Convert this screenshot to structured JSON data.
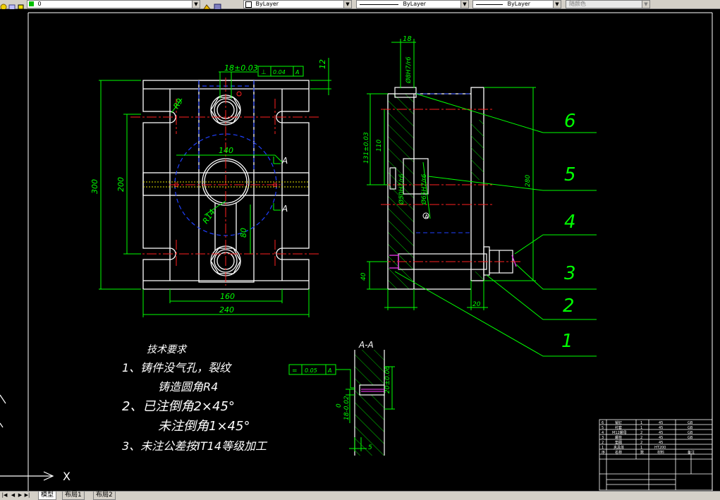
{
  "toolbar": {
    "layer_name": "0",
    "color_label": "ByLayer",
    "linetype_label": "ByLayer",
    "lineweight_label": "ByLayer",
    "plotstyle_label": "随颜色"
  },
  "tabs": [
    {
      "label": "模型",
      "active": true
    },
    {
      "label": "布局1",
      "active": false
    },
    {
      "label": "布局2",
      "active": false
    }
  ],
  "ucs": {
    "x_label": "X"
  },
  "drawing": {
    "front_view": {
      "dim_top": "18±0.03",
      "tolerance_frame": [
        "⊥",
        "0.04",
        "A"
      ],
      "dim_right_top": "12",
      "dim_radius_r9": "R9",
      "dim_140": "140",
      "dim_r14": "R14",
      "dim_80": "80",
      "dim_height_300": "300",
      "dim_height_200": "200",
      "dim_160": "160",
      "dim_240": "240",
      "section_mark_top": "A",
      "section_mark_bottom": "A"
    },
    "side_view": {
      "dim_18": "18",
      "dim_fit_top": "Ø8H7/r6",
      "dim_131": "131±0.03",
      "dim_110": "110",
      "dim_fit_mid1": "Ø50H7/r6",
      "dim_fit_mid2": "Ø65H7/r6",
      "datum_label": "A",
      "dim_280": "280",
      "dim_40": "40",
      "dim_20": "20"
    },
    "callouts": [
      "6",
      "5",
      "4",
      "3",
      "2",
      "1"
    ],
    "section_view": {
      "title": "A-A",
      "tolerance_frame": [
        "=",
        "0.05",
        "A"
      ],
      "dim_0_06": "20±0.06",
      "dim_bottom_1": "0",
      "dim_bottom_2": "18-0.02",
      "dim_5": "5"
    },
    "tech_requirements": {
      "title": "技术要求",
      "lines": [
        "1、铸件没气孔，裂纹",
        "铸造圆角R4",
        "2、已注倒角2×45°",
        "未注倒角1×45°",
        "3、未注公差按IT14等级加工"
      ]
    },
    "title_block": {
      "rows": [
        {
          "no": "6",
          "name": "销钉",
          "qty": "1",
          "material": "45",
          "note": "GB"
        },
        {
          "no": "5",
          "name": "衬套",
          "qty": "1",
          "material": "45",
          "note": "GB"
        },
        {
          "no": "4",
          "name": "M12螺母",
          "qty": "2",
          "material": "45",
          "note": "GB"
        },
        {
          "no": "3",
          "name": "螺栓",
          "qty": "2",
          "material": "45",
          "note": "GB"
        },
        {
          "no": "2",
          "name": "垫圈",
          "qty": "2",
          "material": "45",
          "note": ""
        },
        {
          "no": "1",
          "name": "夹具体",
          "qty": "1",
          "material": "HT200",
          "note": ""
        }
      ],
      "header": {
        "no": "序",
        "name": "名称",
        "qty": "数",
        "material": "材料",
        "note": "备注"
      }
    }
  },
  "colors": {
    "background": "#000000",
    "dimension": "#00ff00",
    "part": "#ffffff",
    "center": "#ff0000",
    "hidden": "#0000ff",
    "hatch": "#00ff00",
    "accent": "#ff00ff"
  }
}
